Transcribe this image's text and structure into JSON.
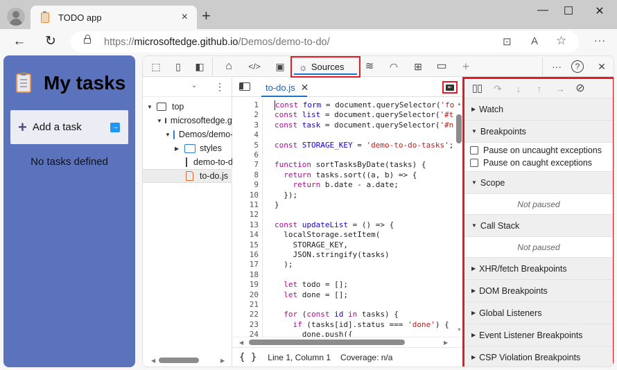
{
  "browser": {
    "tab_title": "TODO app",
    "url_scheme": "https://",
    "url_host": "microsoftedge.github.io",
    "url_path": "/Demos/demo-to-do/",
    "icons": {
      "back": "←",
      "refresh": "↻",
      "new_tab": "+",
      "close_tab": "×",
      "minimize": "—",
      "maximize": "☐",
      "close_window": "✕",
      "apps": "⊡",
      "read_aloud": "A",
      "favorite": "☆",
      "more": "···"
    }
  },
  "todo_app": {
    "title": "My tasks",
    "add_task_placeholder": "Add a task",
    "add_icon": "+",
    "submit_icon": "→",
    "empty_message": "No tasks defined"
  },
  "devtools": {
    "toolbar": {
      "tools": [
        {
          "name": "inspect",
          "glyph": "⬚"
        },
        {
          "name": "device-emulation",
          "glyph": "▯"
        },
        {
          "name": "dock-side",
          "glyph": "◧"
        },
        {
          "name": "welcome",
          "glyph": "⌂"
        },
        {
          "name": "elements",
          "glyph": "</>"
        },
        {
          "name": "console",
          "glyph": "▣"
        }
      ],
      "active_tab": {
        "label": "Sources",
        "glyph": "☼"
      },
      "more_tools": [
        {
          "name": "network",
          "glyph": "≋"
        },
        {
          "name": "performance",
          "glyph": "◠"
        },
        {
          "name": "memory",
          "glyph": "⊞"
        },
        {
          "name": "application",
          "glyph": "▭"
        },
        {
          "name": "more-tools",
          "glyph": "+"
        }
      ],
      "right": {
        "more": "···",
        "help": "?",
        "close": "✕"
      }
    },
    "navigator": {
      "tree": [
        {
          "label": "top",
          "type": "frame",
          "expanded": true,
          "depth": 0
        },
        {
          "label": "microsoftedge.github.io",
          "type": "domain",
          "expanded": true,
          "depth": 1
        },
        {
          "label": "Demos/demo-to-do",
          "type": "folder",
          "expanded": true,
          "depth": 2
        },
        {
          "label": "styles",
          "type": "folder",
          "expanded": false,
          "depth": 3
        },
        {
          "label": "demo-to-do",
          "type": "file",
          "depth": 3
        },
        {
          "label": "to-do.js",
          "type": "js-file",
          "depth": 3,
          "selected": true
        }
      ]
    },
    "editor": {
      "open_file": "to-do.js",
      "lines": [
        {
          "n": "1",
          "code": "const form = document.querySelector('fo"
        },
        {
          "n": "2",
          "code": "const list = document.querySelector('#t"
        },
        {
          "n": "3",
          "code": "const task = document.querySelector('#n"
        },
        {
          "n": "4",
          "code": ""
        },
        {
          "n": "5",
          "code": "const STORAGE_KEY = 'demo-to-do-tasks';"
        },
        {
          "n": "6",
          "code": ""
        },
        {
          "n": "7",
          "code": "function sortTasksByDate(tasks) {"
        },
        {
          "n": "8",
          "code": "  return tasks.sort((a, b) => {"
        },
        {
          "n": "9",
          "code": "    return b.date - a.date;"
        },
        {
          "n": "10",
          "code": "  });"
        },
        {
          "n": "11",
          "code": "}"
        },
        {
          "n": "12",
          "code": ""
        },
        {
          "n": "13",
          "code": "const updateList = () => {"
        },
        {
          "n": "14",
          "code": "  localStorage.setItem("
        },
        {
          "n": "15",
          "code": "    STORAGE_KEY,"
        },
        {
          "n": "16",
          "code": "    JSON.stringify(tasks)"
        },
        {
          "n": "17",
          "code": "  );"
        },
        {
          "n": "18",
          "code": ""
        },
        {
          "n": "19",
          "code": "  let todo = [];"
        },
        {
          "n": "20",
          "code": "  let done = [];"
        },
        {
          "n": "21",
          "code": ""
        },
        {
          "n": "22",
          "code": "  for (const id in tasks) {"
        },
        {
          "n": "23",
          "code": "    if (tasks[id].status === 'done') {"
        },
        {
          "n": "24",
          "code": "      done.push({"
        }
      ],
      "status": {
        "format_icon": "{ }",
        "position": "Line 1, Column 1",
        "coverage": "Coverage: n/a"
      }
    },
    "debugger": {
      "sections": [
        {
          "title": "Watch",
          "expanded": false
        },
        {
          "title": "Breakpoints",
          "expanded": true,
          "checkboxes": [
            "Pause on uncaught exceptions",
            "Pause on caught exceptions"
          ]
        },
        {
          "title": "Scope",
          "expanded": true,
          "message": "Not paused"
        },
        {
          "title": "Call Stack",
          "expanded": true,
          "message": "Not paused"
        },
        {
          "title": "XHR/fetch Breakpoints",
          "expanded": false
        },
        {
          "title": "DOM Breakpoints",
          "expanded": false
        },
        {
          "title": "Global Listeners",
          "expanded": false
        },
        {
          "title": "Event Listener Breakpoints",
          "expanded": false
        },
        {
          "title": "CSP Violation Breakpoints",
          "expanded": false
        }
      ]
    }
  },
  "colors": {
    "todo_bg": "#5b73bd",
    "highlight_red": "#e41b23",
    "accent_blue": "#1a73c8",
    "keyword": "#aa0d91",
    "string": "#c41a16"
  }
}
